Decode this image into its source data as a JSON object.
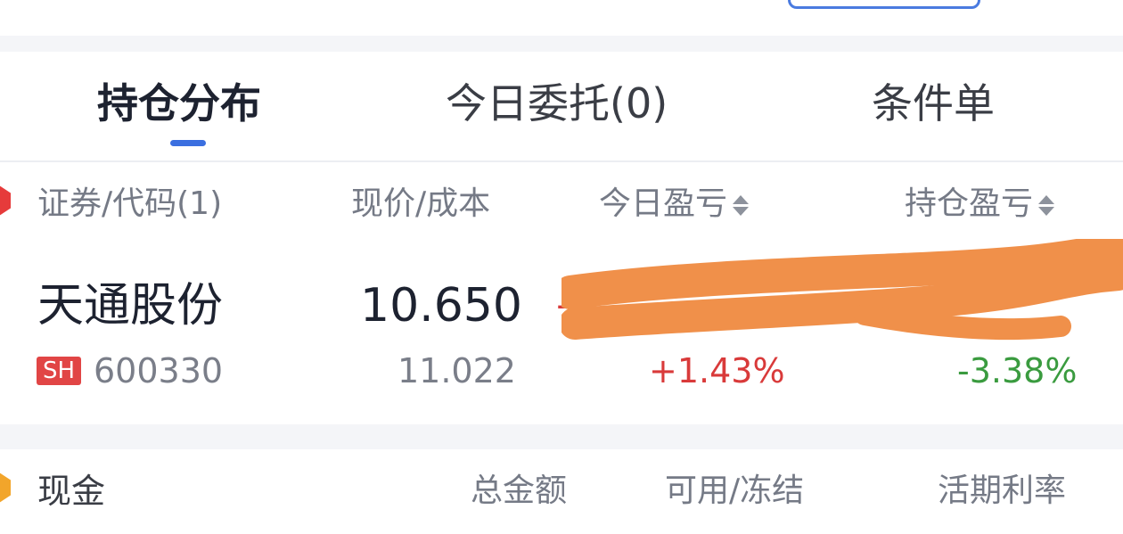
{
  "tabs": [
    {
      "label": "持仓分布",
      "active": true
    },
    {
      "label": "今日委托(0)",
      "active": false
    },
    {
      "label": "条件单",
      "active": false
    }
  ],
  "positions": {
    "columns": {
      "security": "证券/代码(1)",
      "price": "现价/成本",
      "today_pl": "今日盈亏",
      "holding_pl": "持仓盈亏"
    },
    "rows": [
      {
        "name": "天通股份",
        "market": "SH",
        "code": "600330",
        "current_price": "10.650",
        "cost": "11.022",
        "today_pl_pct": "+1.43%",
        "holding_pl_pct": "-3.38%"
      }
    ]
  },
  "cash": {
    "label": "现金",
    "columns": {
      "total": "总金额",
      "available": "可用/冻结",
      "rate": "活期利率"
    }
  },
  "colors": {
    "accent": "#3b6fe0",
    "gain": "#d93a3a",
    "loss": "#3a9b3f",
    "redaction": "#f0904a"
  }
}
